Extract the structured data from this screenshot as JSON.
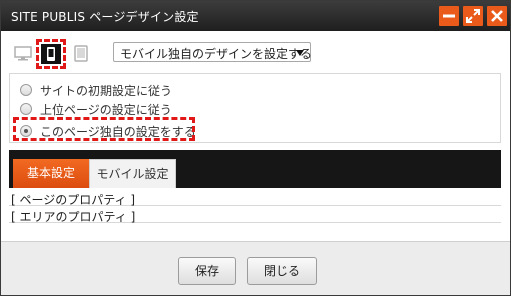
{
  "window": {
    "title": "SITE PUBLIS ページデザイン設定"
  },
  "device_select": {
    "value": "モバイル独自のデザインを設定する"
  },
  "radios": [
    {
      "label": "サイトの初期設定に従う",
      "checked": false
    },
    {
      "label": "上位ページの設定に従う",
      "checked": false
    },
    {
      "label": "このページ独自の設定をする",
      "checked": true
    }
  ],
  "tabs": [
    {
      "label": "基本設定",
      "active": true
    },
    {
      "label": "モバイル設定",
      "active": false
    }
  ],
  "properties": [
    {
      "label": "[ ページのプロパティ ]"
    },
    {
      "label": "[ エリアのプロパティ ]"
    }
  ],
  "footer": {
    "save_label": "保存",
    "close_label": "閉じる"
  },
  "colors": {
    "accent": "#ea5a1b",
    "highlight_outline": "#e01818",
    "titlebar": "#2a2a2a"
  },
  "icons": {
    "minimize": "minimize-icon",
    "maximize": "maximize-icon",
    "close": "close-icon",
    "pc": "desktop-icon",
    "mobile": "mobile-phone-icon",
    "tablet": "tablet-icon"
  }
}
